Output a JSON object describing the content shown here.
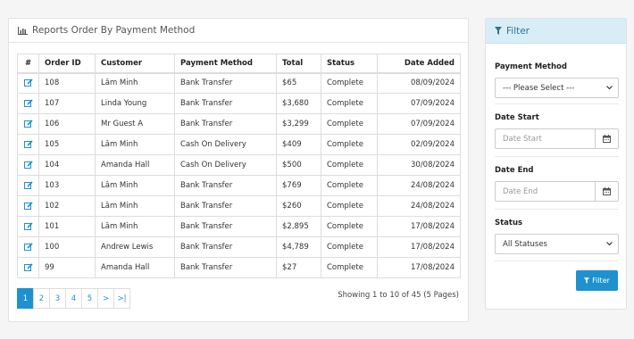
{
  "report": {
    "title": "Reports Order By Payment Method",
    "columns": [
      "#",
      "Order ID",
      "Customer",
      "Payment Method",
      "Total",
      "Status",
      "Date Added"
    ],
    "rows": [
      {
        "id": "108",
        "customer": "Lâm Minh",
        "payment": "Bank Transfer",
        "total": "$65",
        "status": "Complete",
        "date": "08/09/2024"
      },
      {
        "id": "107",
        "customer": "Linda Young",
        "payment": "Bank Transfer",
        "total": "$3,680",
        "status": "Complete",
        "date": "07/09/2024"
      },
      {
        "id": "106",
        "customer": "Mr Guest A",
        "payment": "Bank Transfer",
        "total": "$3,299",
        "status": "Complete",
        "date": "07/09/2024"
      },
      {
        "id": "105",
        "customer": "Lâm Minh",
        "payment": "Cash On Delivery",
        "total": "$409",
        "status": "Complete",
        "date": "02/09/2024"
      },
      {
        "id": "104",
        "customer": "Amanda Hall",
        "payment": "Cash On Delivery",
        "total": "$500",
        "status": "Complete",
        "date": "30/08/2024"
      },
      {
        "id": "103",
        "customer": "Lâm Minh",
        "payment": "Bank Transfer",
        "total": "$769",
        "status": "Complete",
        "date": "24/08/2024"
      },
      {
        "id": "102",
        "customer": "Lâm Minh",
        "payment": "Bank Transfer",
        "total": "$260",
        "status": "Complete",
        "date": "24/08/2024"
      },
      {
        "id": "101",
        "customer": "Lâm Minh",
        "payment": "Bank Transfer",
        "total": "$2,895",
        "status": "Complete",
        "date": "17/08/2024"
      },
      {
        "id": "100",
        "customer": "Andrew Lewis",
        "payment": "Bank Transfer",
        "total": "$4,789",
        "status": "Complete",
        "date": "17/08/2024"
      },
      {
        "id": "99",
        "customer": "Amanda Hall",
        "payment": "Bank Transfer",
        "total": "$27",
        "status": "Complete",
        "date": "17/08/2024"
      }
    ],
    "pagination": [
      "1",
      "2",
      "3",
      "4",
      "5",
      ">",
      ">|"
    ],
    "pagination_active": "1",
    "summary": "Showing 1 to 10 of 45 (5 Pages)"
  },
  "filter": {
    "title": "Filter",
    "payment_method_label": "Payment Method",
    "payment_method_value": "--- Please Select ---",
    "date_start_label": "Date Start",
    "date_start_placeholder": "Date Start",
    "date_end_label": "Date End",
    "date_end_placeholder": "Date End",
    "status_label": "Status",
    "status_value": "All Statuses",
    "button_label": "Filter"
  },
  "colors": {
    "accent": "#1e91cf",
    "filter_header_bg": "#d9edf7",
    "filter_header_text": "#31708f"
  },
  "icons": {
    "report_title": "bar-chart-icon",
    "row_action": "edit-icon",
    "filter_title": "filter-icon",
    "date_button": "calendar-icon",
    "select_arrow": "chevron-down-icon"
  }
}
